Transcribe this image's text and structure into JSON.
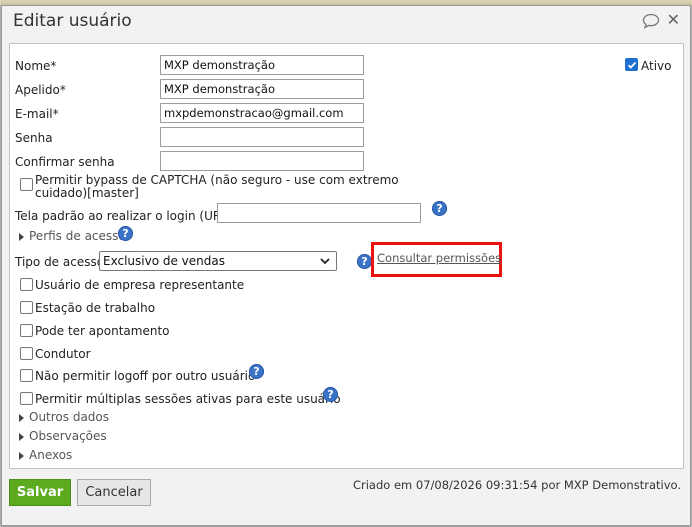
{
  "dialog": {
    "title": "Editar usuário",
    "icons": {
      "chat": "chat-bubble-icon",
      "close": "close-icon"
    }
  },
  "form": {
    "nome": {
      "label": "Nome*",
      "value": "MXP demonstração"
    },
    "apelido": {
      "label": "Apelido*",
      "value": "MXP demonstração"
    },
    "email": {
      "label": "E-mail*",
      "value": "mxpdemonstracao@gmail.com"
    },
    "senha": {
      "label": "Senha",
      "value": ""
    },
    "confirmar_senha": {
      "label": "Confirmar senha",
      "value": ""
    },
    "ativo": {
      "label": "Ativo",
      "checked": true
    },
    "captcha": {
      "label_line1": "Permitir bypass de CAPTCHA (não seguro - use com extremo",
      "label_line2": "cuidado)[master]",
      "checked": false
    },
    "tela_padrao": {
      "label": "Tela padrão ao realizar o login (URL)",
      "value": ""
    },
    "perfis_acesso": {
      "label": "Perfis de acesso"
    },
    "tipo_acesso": {
      "label": "Tipo de acesso",
      "selected": "Exclusivo de vendas"
    },
    "consultar_permissoes": "Consultar permissões",
    "checkboxes": [
      {
        "label": "Usuário de empresa representante",
        "checked": false
      },
      {
        "label": "Estação de trabalho",
        "checked": false
      },
      {
        "label": "Pode ter apontamento",
        "checked": false
      },
      {
        "label": "Condutor",
        "checked": false
      },
      {
        "label": "Não permitir logoff por outro usuário",
        "checked": false
      },
      {
        "label": "Permitir múltiplas sessões ativas para este usuário",
        "checked": false
      }
    ],
    "sections": [
      "Outros dados",
      "Observações",
      "Anexos"
    ],
    "help_glyph": "?"
  },
  "footer": {
    "save_label": "Salvar",
    "cancel_label": "Cancelar",
    "created_text": "Criado em 07/08/2026 09:31:54 por MXP Demonstrativo."
  },
  "colors": {
    "accent": "#1f6fd1",
    "save": "#5cab1f",
    "highlight": "#ee1111",
    "help": "#3b73c8"
  }
}
